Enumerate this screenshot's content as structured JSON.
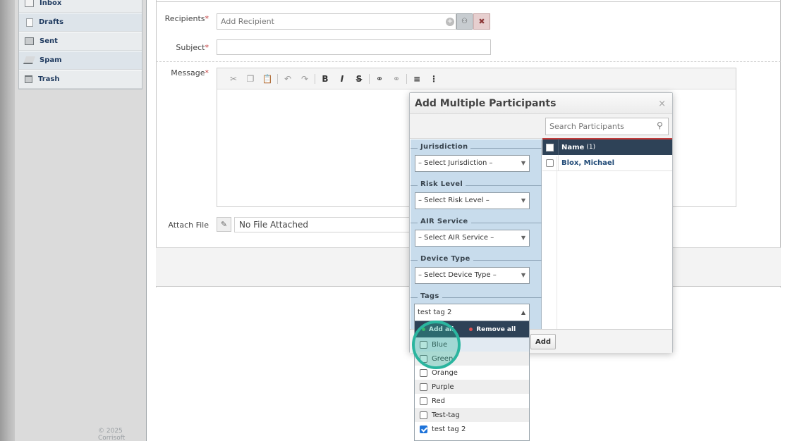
{
  "sidebar": {
    "items": [
      {
        "label": "Inbox",
        "icon": "inbox-icon"
      },
      {
        "label": "Drafts",
        "icon": "drafts-icon"
      },
      {
        "label": "Sent",
        "icon": "sent-icon"
      },
      {
        "label": "Spam",
        "icon": "spam-icon"
      },
      {
        "label": "Trash",
        "icon": "trash-icon"
      }
    ],
    "copyright": "© 2025 Corrisoft"
  },
  "compose": {
    "recipients_label": "Recipients",
    "recipients_placeholder": "Add Recipient",
    "subject_label": "Subject",
    "subject_value": "",
    "message_label": "Message",
    "required_mark": "*",
    "attach_label": "Attach File",
    "attach_value": "No File Attached",
    "toolbar": [
      "cut",
      "copy",
      "paste",
      "undo",
      "redo",
      "bold",
      "italic",
      "strikethrough",
      "link",
      "unlink",
      "numbered-list",
      "bulleted-list"
    ],
    "toolbar_glyphs": {
      "bold": "B",
      "italic": "I",
      "strikethrough": "S"
    }
  },
  "modal": {
    "title": "Add Multiple Participants",
    "close": "×",
    "search_placeholder": "Search Participants",
    "filters": [
      {
        "legend": "Jurisdiction",
        "value": "– Select Jurisdiction –"
      },
      {
        "legend": "Risk Level",
        "value": "– Select Risk Level –"
      },
      {
        "legend": "AIR Service",
        "value": "– Select AIR Service –"
      },
      {
        "legend": "Device Type",
        "value": "– Select Device Type –"
      }
    ],
    "tags_legend": "Tags",
    "tags_value": "test tag 2",
    "results": {
      "header": "Name",
      "count": "(1)",
      "rows": [
        "Blox, Michael"
      ]
    },
    "add_button": "Add"
  },
  "tags_dropdown": {
    "add_all": "Add all",
    "remove_all": "Remove all",
    "options": [
      {
        "label": "Blue",
        "checked": false
      },
      {
        "label": "Green",
        "checked": false
      },
      {
        "label": "Orange",
        "checked": false
      },
      {
        "label": "Purple",
        "checked": false
      },
      {
        "label": "Red",
        "checked": false
      },
      {
        "label": "Test-tag",
        "checked": false
      },
      {
        "label": "test tag 2",
        "checked": true
      }
    ]
  },
  "colors": {
    "nav_text": "#1f3a5f",
    "header_dark": "#2e4257",
    "required": "#c23b3b",
    "filter_bg": "#c8dcec",
    "highlight": "#2bb59f",
    "checkbox_checked": "#1e73d9"
  }
}
